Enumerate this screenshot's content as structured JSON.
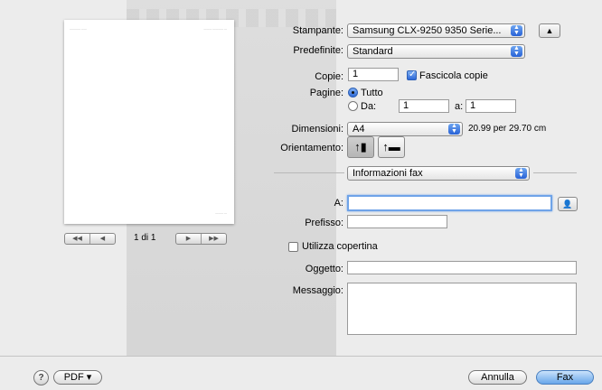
{
  "printer": {
    "label": "Stampante:",
    "value": "Samsung CLX-9250 9350 Serie..."
  },
  "presets": {
    "label": "Predefinite:",
    "value": "Standard"
  },
  "copies": {
    "label": "Copie:",
    "value": "1",
    "collate_label": "Fascicola copie",
    "collate_checked": true
  },
  "pages": {
    "label": "Pagine:",
    "all_label": "Tutto",
    "from_label": "Da:",
    "from_value": "1",
    "to_label": "a:",
    "to_value": "1"
  },
  "paper_size": {
    "label": "Dimensioni:",
    "value": "A4",
    "dimensions": "20.99 per 29.70 cm"
  },
  "orientation": {
    "label": "Orientamento:",
    "portrait_icon": "portrait-person-icon",
    "landscape_icon": "landscape-person-icon"
  },
  "section": {
    "value": "Informazioni fax"
  },
  "fax": {
    "to_label": "A:",
    "to_value": "",
    "prefix_label": "Prefisso:",
    "prefix_value": "",
    "cover_label": "Utilizza copertina",
    "cover_checked": false,
    "subject_label": "Oggetto:",
    "subject_value": "",
    "message_label": "Messaggio:",
    "message_value": ""
  },
  "preview": {
    "page_indicator": "1 di 1",
    "nav_icons": [
      "first-page-icon",
      "prev-page-icon",
      "next-page-icon",
      "last-page-icon"
    ]
  },
  "footer": {
    "help": "?",
    "pdf_label": "PDF ▾",
    "cancel_label": "Annulla",
    "fax_label": "Fax"
  },
  "colors": {
    "accent": "#3a78e0",
    "focus_ring": "#6fa3e8"
  }
}
